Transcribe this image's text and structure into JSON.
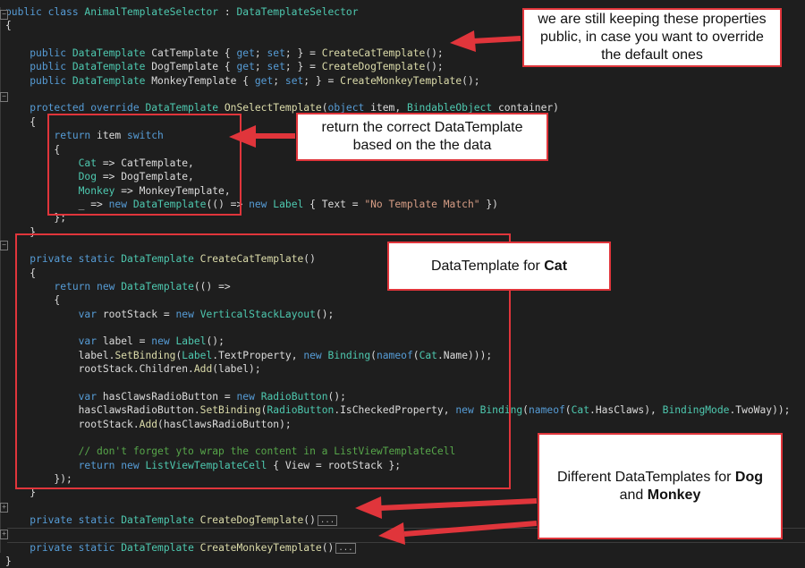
{
  "editor": {
    "lines": [
      [
        [
          "kw",
          "public class "
        ],
        [
          "ty",
          "AnimalTemplateSelector"
        ],
        [
          "pl",
          " : "
        ],
        [
          "ty",
          "DataTemplateSelector"
        ]
      ],
      [
        [
          "pl",
          "{"
        ]
      ],
      [],
      [
        [
          "pl",
          "    "
        ],
        [
          "kw",
          "public "
        ],
        [
          "ty",
          "DataTemplate "
        ],
        [
          "pl",
          "CatTemplate { "
        ],
        [
          "kw",
          "get"
        ],
        [
          "pl",
          "; "
        ],
        [
          "kw",
          "set"
        ],
        [
          "pl",
          "; } = "
        ],
        [
          "fn",
          "CreateCatTemplate"
        ],
        [
          "pl",
          "();"
        ]
      ],
      [
        [
          "pl",
          "    "
        ],
        [
          "kw",
          "public "
        ],
        [
          "ty",
          "DataTemplate "
        ],
        [
          "pl",
          "DogTemplate { "
        ],
        [
          "kw",
          "get"
        ],
        [
          "pl",
          "; "
        ],
        [
          "kw",
          "set"
        ],
        [
          "pl",
          "; } = "
        ],
        [
          "fn",
          "CreateDogTemplate"
        ],
        [
          "pl",
          "();"
        ]
      ],
      [
        [
          "pl",
          "    "
        ],
        [
          "kw",
          "public "
        ],
        [
          "ty",
          "DataTemplate "
        ],
        [
          "pl",
          "MonkeyTemplate { "
        ],
        [
          "kw",
          "get"
        ],
        [
          "pl",
          "; "
        ],
        [
          "kw",
          "set"
        ],
        [
          "pl",
          "; } = "
        ],
        [
          "fn",
          "CreateMonkeyTemplate"
        ],
        [
          "pl",
          "();"
        ]
      ],
      [],
      [
        [
          "pl",
          "    "
        ],
        [
          "kw",
          "protected override "
        ],
        [
          "ty",
          "DataTemplate "
        ],
        [
          "fn",
          "OnSelectTemplate"
        ],
        [
          "pl",
          "("
        ],
        [
          "kw",
          "object "
        ],
        [
          "pl",
          "item, "
        ],
        [
          "ty",
          "BindableObject "
        ],
        [
          "pl",
          "container)"
        ]
      ],
      [
        [
          "pl",
          "    {"
        ]
      ],
      [
        [
          "pl",
          "        "
        ],
        [
          "kw",
          "return "
        ],
        [
          "pl",
          "item "
        ],
        [
          "kw",
          "switch"
        ]
      ],
      [
        [
          "pl",
          "        {"
        ]
      ],
      [
        [
          "pl",
          "            "
        ],
        [
          "ty",
          "Cat "
        ],
        [
          "pl",
          "=> CatTemplate,"
        ]
      ],
      [
        [
          "pl",
          "            "
        ],
        [
          "ty",
          "Dog "
        ],
        [
          "pl",
          "=> DogTemplate,"
        ]
      ],
      [
        [
          "pl",
          "            "
        ],
        [
          "ty",
          "Monkey "
        ],
        [
          "pl",
          "=> MonkeyTemplate,"
        ]
      ],
      [
        [
          "pl",
          "            _ => "
        ],
        [
          "kw",
          "new "
        ],
        [
          "ty",
          "DataTemplate"
        ],
        [
          "pl",
          "(() => "
        ],
        [
          "kw",
          "new "
        ],
        [
          "ty",
          "Label "
        ],
        [
          "pl",
          "{ Text = "
        ],
        [
          "st",
          "\"No Template Match\""
        ],
        [
          "pl",
          " })"
        ]
      ],
      [
        [
          "pl",
          "        };"
        ]
      ],
      [
        [
          "pl",
          "    }"
        ]
      ],
      [],
      [
        [
          "pl",
          "    "
        ],
        [
          "kw",
          "private static "
        ],
        [
          "ty",
          "DataTemplate "
        ],
        [
          "fn",
          "CreateCatTemplate"
        ],
        [
          "pl",
          "()"
        ]
      ],
      [
        [
          "pl",
          "    {"
        ]
      ],
      [
        [
          "pl",
          "        "
        ],
        [
          "kw",
          "return new "
        ],
        [
          "ty",
          "DataTemplate"
        ],
        [
          "pl",
          "(() =>"
        ]
      ],
      [
        [
          "pl",
          "        {"
        ]
      ],
      [
        [
          "pl",
          "            "
        ],
        [
          "kw",
          "var "
        ],
        [
          "pl",
          "rootStack = "
        ],
        [
          "kw",
          "new "
        ],
        [
          "ty",
          "VerticalStackLayout"
        ],
        [
          "pl",
          "();"
        ]
      ],
      [],
      [
        [
          "pl",
          "            "
        ],
        [
          "kw",
          "var "
        ],
        [
          "pl",
          "label = "
        ],
        [
          "kw",
          "new "
        ],
        [
          "ty",
          "Label"
        ],
        [
          "pl",
          "();"
        ]
      ],
      [
        [
          "pl",
          "            label."
        ],
        [
          "fn",
          "SetBinding"
        ],
        [
          "pl",
          "("
        ],
        [
          "ty",
          "Label"
        ],
        [
          "pl",
          ".TextProperty, "
        ],
        [
          "kw",
          "new "
        ],
        [
          "ty",
          "Binding"
        ],
        [
          "pl",
          "("
        ],
        [
          "kw",
          "nameof"
        ],
        [
          "pl",
          "("
        ],
        [
          "ty",
          "Cat"
        ],
        [
          "pl",
          ".Name)));"
        ]
      ],
      [
        [
          "pl",
          "            rootStack.Children."
        ],
        [
          "fn",
          "Add"
        ],
        [
          "pl",
          "(label);"
        ]
      ],
      [],
      [
        [
          "pl",
          "            "
        ],
        [
          "kw",
          "var "
        ],
        [
          "pl",
          "hasClawsRadioButton = "
        ],
        [
          "kw",
          "new "
        ],
        [
          "ty",
          "RadioButton"
        ],
        [
          "pl",
          "();"
        ]
      ],
      [
        [
          "pl",
          "            hasClawsRadioButton."
        ],
        [
          "fn",
          "SetBinding"
        ],
        [
          "pl",
          "("
        ],
        [
          "ty",
          "RadioButton"
        ],
        [
          "pl",
          ".IsCheckedProperty, "
        ],
        [
          "kw",
          "new "
        ],
        [
          "ty",
          "Binding"
        ],
        [
          "pl",
          "("
        ],
        [
          "kw",
          "nameof"
        ],
        [
          "pl",
          "("
        ],
        [
          "ty",
          "Cat"
        ],
        [
          "pl",
          ".HasClaws), "
        ],
        [
          "ty",
          "BindingMode"
        ],
        [
          "pl",
          ".TwoWay));"
        ]
      ],
      [
        [
          "pl",
          "            rootStack."
        ],
        [
          "fn",
          "Add"
        ],
        [
          "pl",
          "(hasClawsRadioButton);"
        ]
      ],
      [],
      [
        [
          "pl",
          "            "
        ],
        [
          "cm",
          "// don't forget yto wrap the content in a ListViewTemplateCell"
        ]
      ],
      [
        [
          "pl",
          "            "
        ],
        [
          "kw",
          "return new "
        ],
        [
          "ty",
          "ListViewTemplateCell "
        ],
        [
          "pl",
          "{ View = rootStack };"
        ]
      ],
      [
        [
          "pl",
          "        });"
        ]
      ],
      [
        [
          "pl",
          "    }"
        ]
      ],
      [],
      [
        [
          "pl",
          "    "
        ],
        [
          "kw",
          "private static "
        ],
        [
          "ty",
          "DataTemplate "
        ],
        [
          "fn",
          "CreateDogTemplate"
        ],
        [
          "pl",
          "()"
        ]
      ],
      [],
      [
        [
          "pl",
          "    "
        ],
        [
          "kw",
          "private static "
        ],
        [
          "ty",
          "DataTemplate "
        ],
        [
          "fn",
          "CreateMonkeyTemplate"
        ],
        [
          "pl",
          "()"
        ]
      ],
      [
        [
          "pl",
          "}"
        ]
      ]
    ],
    "collapsed_marker": "..."
  },
  "callouts": {
    "properties": "we are still keeping these properties public, in case you want to override the default ones",
    "switch_prefix": "return the correct DataTemplate based on the the data",
    "cat_prefix": "DataTemplate for ",
    "cat_bold": "Cat",
    "others_prefix": "Different DataTemplates for ",
    "others_bold1": "Dog",
    "others_mid": "and",
    "others_bold2": "Monkey"
  },
  "colors": {
    "keyword": "#569cd6",
    "type": "#4ec9b0",
    "method": "#dcdcaa",
    "string": "#d69d85",
    "comment": "#57a64a",
    "annotation": "#e0353b",
    "background": "#1e1e1e"
  }
}
